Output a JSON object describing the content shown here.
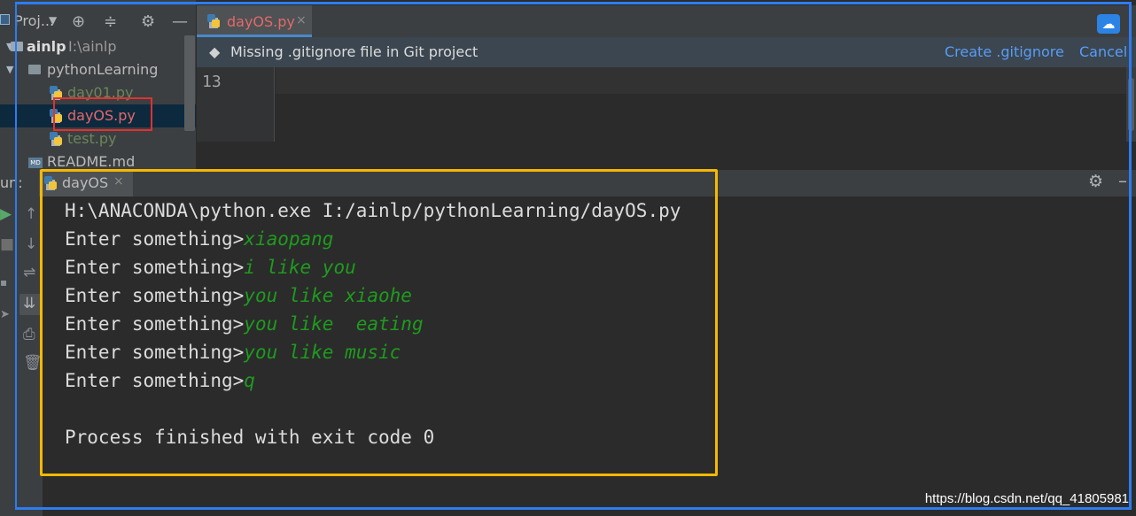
{
  "project": {
    "title": "Proj...",
    "header_buttons": [
      "dropdown-icon",
      "crosshair-icon",
      "collapse-icon",
      "gear-icon",
      "minimize-icon"
    ],
    "tree": [
      {
        "label": "ainlp",
        "path": "I:\\ainlp",
        "type": "folder"
      },
      {
        "label": "pythonLearning",
        "type": "folder"
      },
      {
        "label": "day01.py",
        "type": "file"
      },
      {
        "label": "dayOS.py",
        "type": "file"
      },
      {
        "label": "test.py",
        "type": "file"
      },
      {
        "label": "README.md",
        "type": "file"
      }
    ]
  },
  "editor": {
    "tab": {
      "label": "dayOS.py",
      "close": "×"
    },
    "notice": {
      "text": "Missing .gitignore file in Git project",
      "create_link": "Create .gitignore",
      "cancel_link": "Cancel"
    },
    "line_number": "13"
  },
  "run": {
    "label": "un:",
    "tab_label": "dayOS",
    "tab_close": "×",
    "console": [
      {
        "text": "H:\\ANACONDA\\python.exe I:/ainlp/pythonLearning/dayOS.py",
        "input": ""
      },
      {
        "text": "Enter something>",
        "input": "xiaopang"
      },
      {
        "text": "Enter something>",
        "input": "i like you"
      },
      {
        "text": "Enter something>",
        "input": "you like xiaohe"
      },
      {
        "text": "Enter something>",
        "input": "you like  eating"
      },
      {
        "text": "Enter something>",
        "input": "you like music"
      },
      {
        "text": "Enter something>",
        "input": "q"
      },
      {
        "text": "Process finished with exit code 0",
        "input": ""
      }
    ]
  },
  "watermark": "https://blog.csdn.net/qq_41805981",
  "colors": {
    "input_text": "#1e9b1e",
    "annotation_red": "#e03131",
    "annotation_yellow": "#f5b800",
    "annotation_blue": "#2d7cf0"
  }
}
